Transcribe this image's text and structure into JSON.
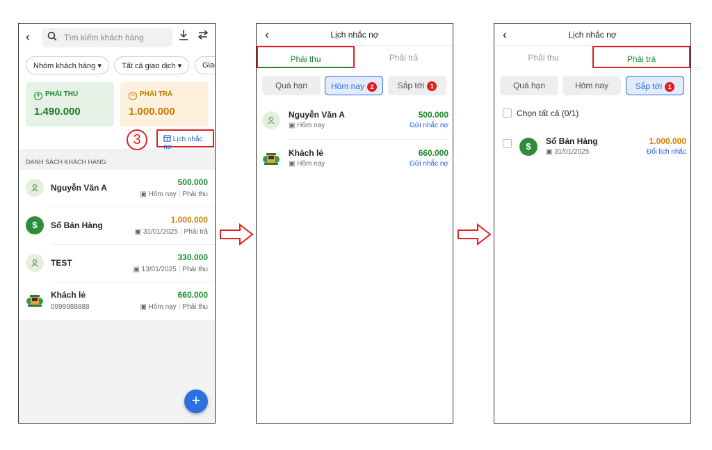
{
  "screen1": {
    "search_placeholder": "Tìm kiếm khách hàng",
    "chips": [
      "Nhóm khách hàng ▾",
      "Tất cả giao dịch ▾",
      "Giao"
    ],
    "card_receivable": {
      "label": "PHẢI THU",
      "value": "1.490.000"
    },
    "card_payable": {
      "label": "PHẢI TRẢ",
      "value": "1.000.000"
    },
    "step_number": "3",
    "reminder_button": "Lịch nhắc nợ",
    "section_title": "DANH SÁCH KHÁCH HÀNG",
    "customers": [
      {
        "name": "Nguyễn Văn A",
        "sub": "",
        "amount": "500.000",
        "date": "Hôm nay",
        "kind": "Phải thu",
        "color": "#1a8a2a"
      },
      {
        "name": "Sổ Bán Hàng",
        "sub": "",
        "amount": "1.000.000",
        "date": "31/01/2025",
        "kind": "Phải trả",
        "color": "#d08100"
      },
      {
        "name": "TEST",
        "sub": "",
        "amount": "330.000",
        "date": "13/01/2025",
        "kind": "Phải thu",
        "color": "#1a8a2a"
      },
      {
        "name": "Khách lẻ",
        "sub": "0999988888",
        "amount": "660.000",
        "date": "Hôm nay",
        "kind": "Phải thu",
        "color": "#1a8a2a"
      }
    ],
    "fab": "+"
  },
  "screen2": {
    "title": "Lịch nhắc nợ",
    "tab_receivable": "Phải thu",
    "tab_payable": "Phải trả",
    "seg_overdue": "Quá hạn",
    "seg_today": "Hôm nay",
    "seg_today_badge": "2",
    "seg_upcoming": "Sắp tới",
    "seg_upcoming_badge": "1",
    "items": [
      {
        "name": "Nguyễn Văn A",
        "date": "Hôm nay",
        "amount": "500.000",
        "action": "Gửi nhắc nợ"
      },
      {
        "name": "Khách lẻ",
        "date": "Hôm nay",
        "amount": "660.000",
        "action": "Gửi nhắc nợ"
      }
    ]
  },
  "screen3": {
    "title": "Lịch nhắc nợ",
    "tab_receivable": "Phải thu",
    "tab_payable": "Phải trả",
    "seg_overdue": "Quá hạn",
    "seg_today": "Hôm nay",
    "seg_upcoming": "Sắp tới",
    "seg_upcoming_badge": "1",
    "select_all": "Chọn tất cả (0/1)",
    "items": [
      {
        "name": "Sổ Bán Hàng",
        "date": "31/01/2025",
        "amount": "1.000.000",
        "action": "Đổi lịch nhắc"
      }
    ]
  },
  "colors": {
    "green": "#1a8a2a",
    "orange": "#d08100",
    "blue": "#2b6fe0",
    "red": "#e02020"
  }
}
